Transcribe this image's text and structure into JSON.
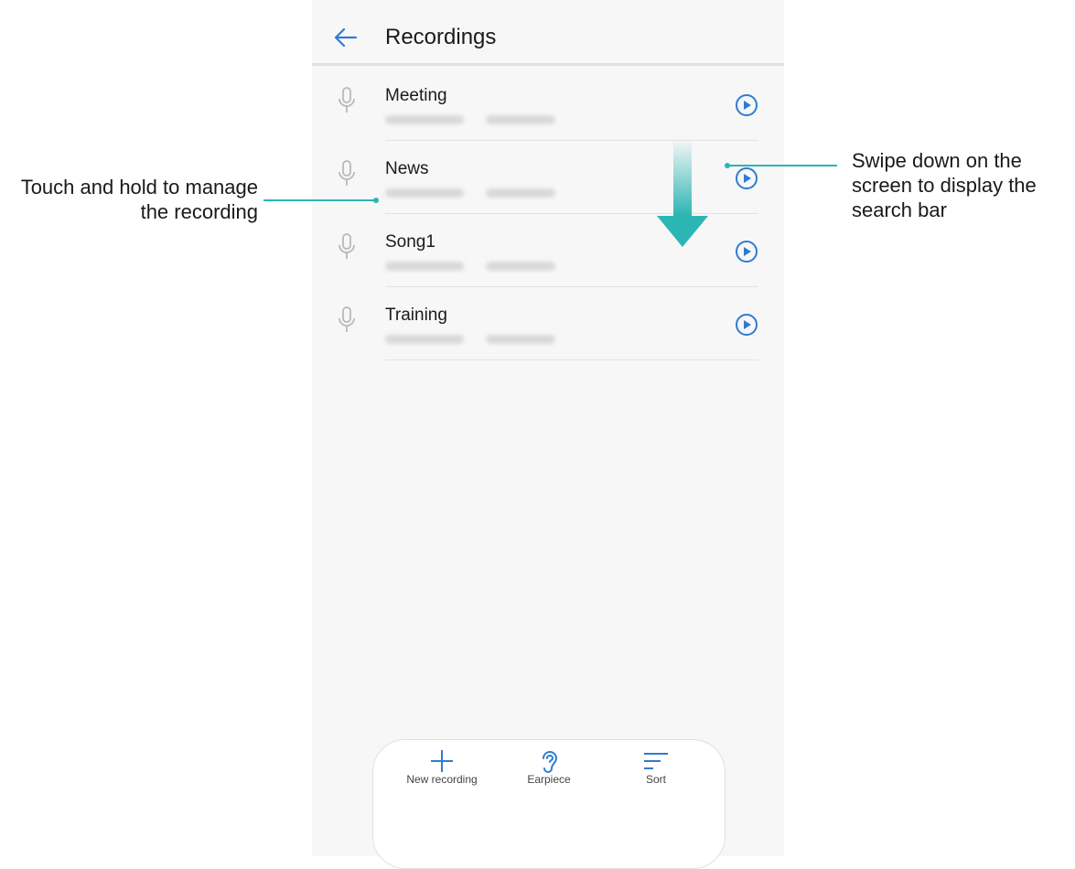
{
  "header": {
    "title": "Recordings"
  },
  "recordings": [
    {
      "name": "Meeting"
    },
    {
      "name": "News"
    },
    {
      "name": "Song1"
    },
    {
      "name": "Training"
    }
  ],
  "bottom_bar": {
    "new_recording": "New recording",
    "earpiece": "Earpiece",
    "sort": "Sort"
  },
  "callouts": {
    "left": "Touch and hold to manage the recording",
    "right": "Swipe down on the screen to display the search bar"
  },
  "colors": {
    "accent": "#2f7bd1",
    "callout": "#2bb5b3",
    "mic_icon": "#b9b9b9"
  },
  "icons": {
    "back": "arrow-left-icon",
    "mic": "microphone-icon",
    "play": "play-circle-icon",
    "add": "plus-icon",
    "earpiece": "ear-icon",
    "sort": "sort-lines-icon",
    "swipe": "swipe-down-arrow-icon"
  }
}
